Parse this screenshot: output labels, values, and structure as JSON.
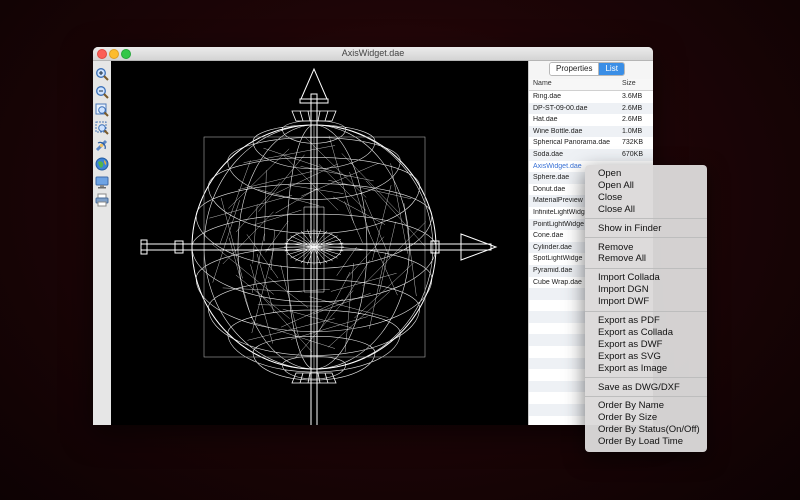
{
  "window": {
    "title": "AxisWidget.dae"
  },
  "toolbar": {
    "tools": [
      "zoom-in-icon",
      "zoom-out-icon",
      "zoom-fit-icon",
      "zoom-selection-icon",
      "rotate-icon",
      "globe-icon",
      "monitor-icon",
      "print-icon"
    ]
  },
  "sidepanel": {
    "tabs": {
      "properties": "Properties",
      "list": "List"
    },
    "columns": {
      "name": "Name",
      "size": "Size"
    },
    "files": [
      {
        "name": "Ring.dae",
        "size": "3.6MB"
      },
      {
        "name": "DP-ST-09-00.dae",
        "size": "2.6MB"
      },
      {
        "name": "Hat.dae",
        "size": "2.6MB"
      },
      {
        "name": "Wine Bottle.dae",
        "size": "1.0MB"
      },
      {
        "name": "Spherical Panorama.dae",
        "size": "732KB"
      },
      {
        "name": "Soda.dae",
        "size": "670KB"
      },
      {
        "name": "AxisWidget.dae",
        "size": "",
        "selected": true
      },
      {
        "name": "Sphere.dae",
        "size": ""
      },
      {
        "name": "Donut.dae",
        "size": ""
      },
      {
        "name": "MaterialPreview",
        "size": ""
      },
      {
        "name": "InfiniteLightWidg",
        "size": ""
      },
      {
        "name": "PointLightWidge",
        "size": ""
      },
      {
        "name": "Cone.dae",
        "size": ""
      },
      {
        "name": "Cylinder.dae",
        "size": ""
      },
      {
        "name": "SpotLightWidge",
        "size": ""
      },
      {
        "name": "Pyramid.dae",
        "size": ""
      },
      {
        "name": "Cube Wrap.dae",
        "size": ""
      }
    ]
  },
  "context_menu": {
    "groups": [
      [
        "Open",
        "Open All",
        "Close",
        "Close All"
      ],
      [
        "Show in Finder"
      ],
      [
        "Remove",
        "Remove All"
      ],
      [
        "Import Collada",
        "Import DGN",
        "Import DWF"
      ],
      [
        "Export as PDF",
        "Export as Collada",
        "Export as DWF",
        "Export as SVG",
        "Export as Image"
      ],
      [
        "Save as DWG/DXF"
      ],
      [
        "Order By Name",
        "Order By Size",
        "Order By Status(On/Off)",
        "Order By Load Time"
      ]
    ]
  },
  "colors": {
    "accent": "#3a8ee6",
    "selected_text": "#3a72d6",
    "viewport_bg": "#000000",
    "wireframe": "#ffffff"
  }
}
